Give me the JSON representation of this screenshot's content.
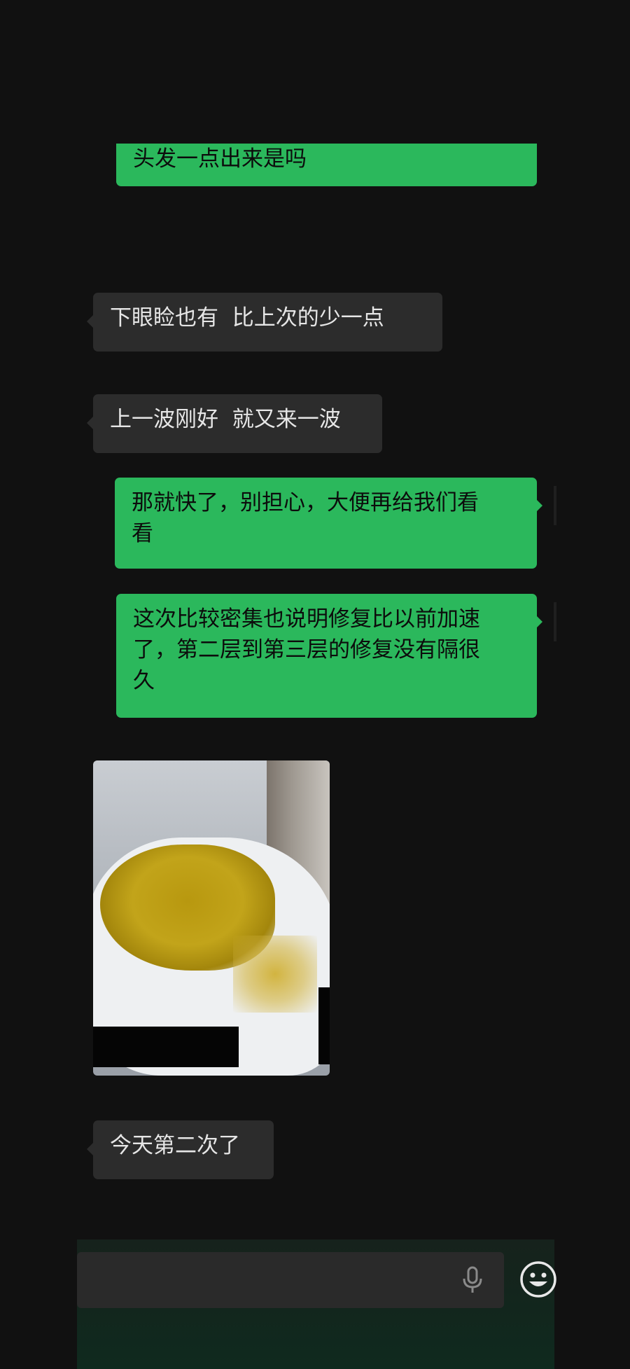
{
  "messages": [
    {
      "side": "out",
      "text": "头发一点出来是吗"
    },
    {
      "side": "in",
      "text": "下眼睑也有  比上次的少一点"
    },
    {
      "side": "in",
      "text": "上一波刚好  就又来一波"
    },
    {
      "side": "out",
      "text": "那就快了，别担心，大便再给我们看\n看"
    },
    {
      "side": "out",
      "text": "这次比较密集也说明修复比以前加速\n了，第二层到第三层的修复没有隔很\n久"
    },
    {
      "side": "in",
      "type": "image",
      "icon": "photo-image"
    },
    {
      "side": "in",
      "text": "今天第二次了"
    }
  ],
  "input_bar": {
    "mic_icon": "microphone-icon",
    "emoji_icon": "emoji-icon"
  },
  "colors": {
    "background": "#111111",
    "incoming_bubble": "#2c2c2c",
    "outgoing_bubble": "#2bb85c",
    "incoming_text": "#e6e6e6",
    "outgoing_text": "#0c0c0c"
  }
}
